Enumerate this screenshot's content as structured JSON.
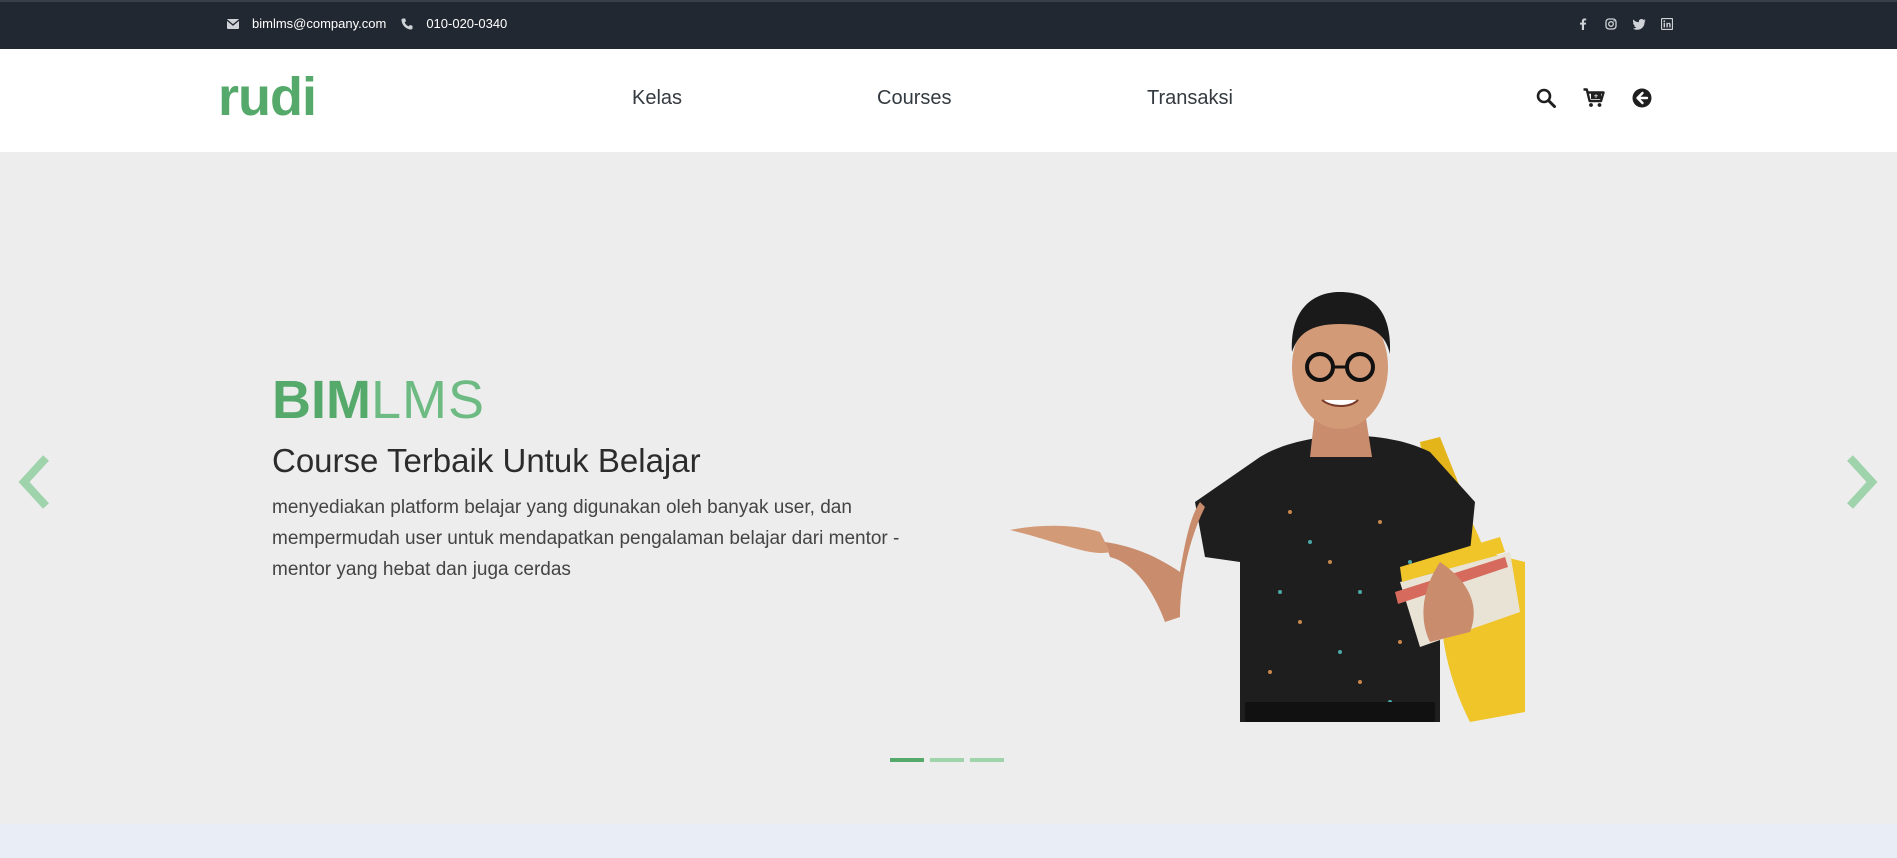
{
  "topbar": {
    "email": "bimlms@company.com",
    "phone": "010-020-0340",
    "social": [
      "facebook-icon",
      "instagram-icon",
      "twitter-icon",
      "linkedin-icon"
    ]
  },
  "navbar": {
    "brand": "rudi",
    "menu": [
      "Kelas",
      "Courses",
      "Transaksi"
    ],
    "icons": [
      "search-icon",
      "cart-icon",
      "back-icon"
    ]
  },
  "hero": {
    "title_bold": "BIM",
    "title_light": "LMS",
    "subtitle": "Course Terbaik Untuk Belajar",
    "description": "menyediakan platform belajar yang digunakan oleh banyak user, dan mempermudah user untuk mendapatkan pengalaman belajar dari mentor - mentor yang hebat dan juga cerdas",
    "slides_total": 3,
    "active_slide": 1
  },
  "colors": {
    "accent": "#55a96b",
    "topbar_bg": "#222831",
    "hero_bg": "#ededed"
  }
}
